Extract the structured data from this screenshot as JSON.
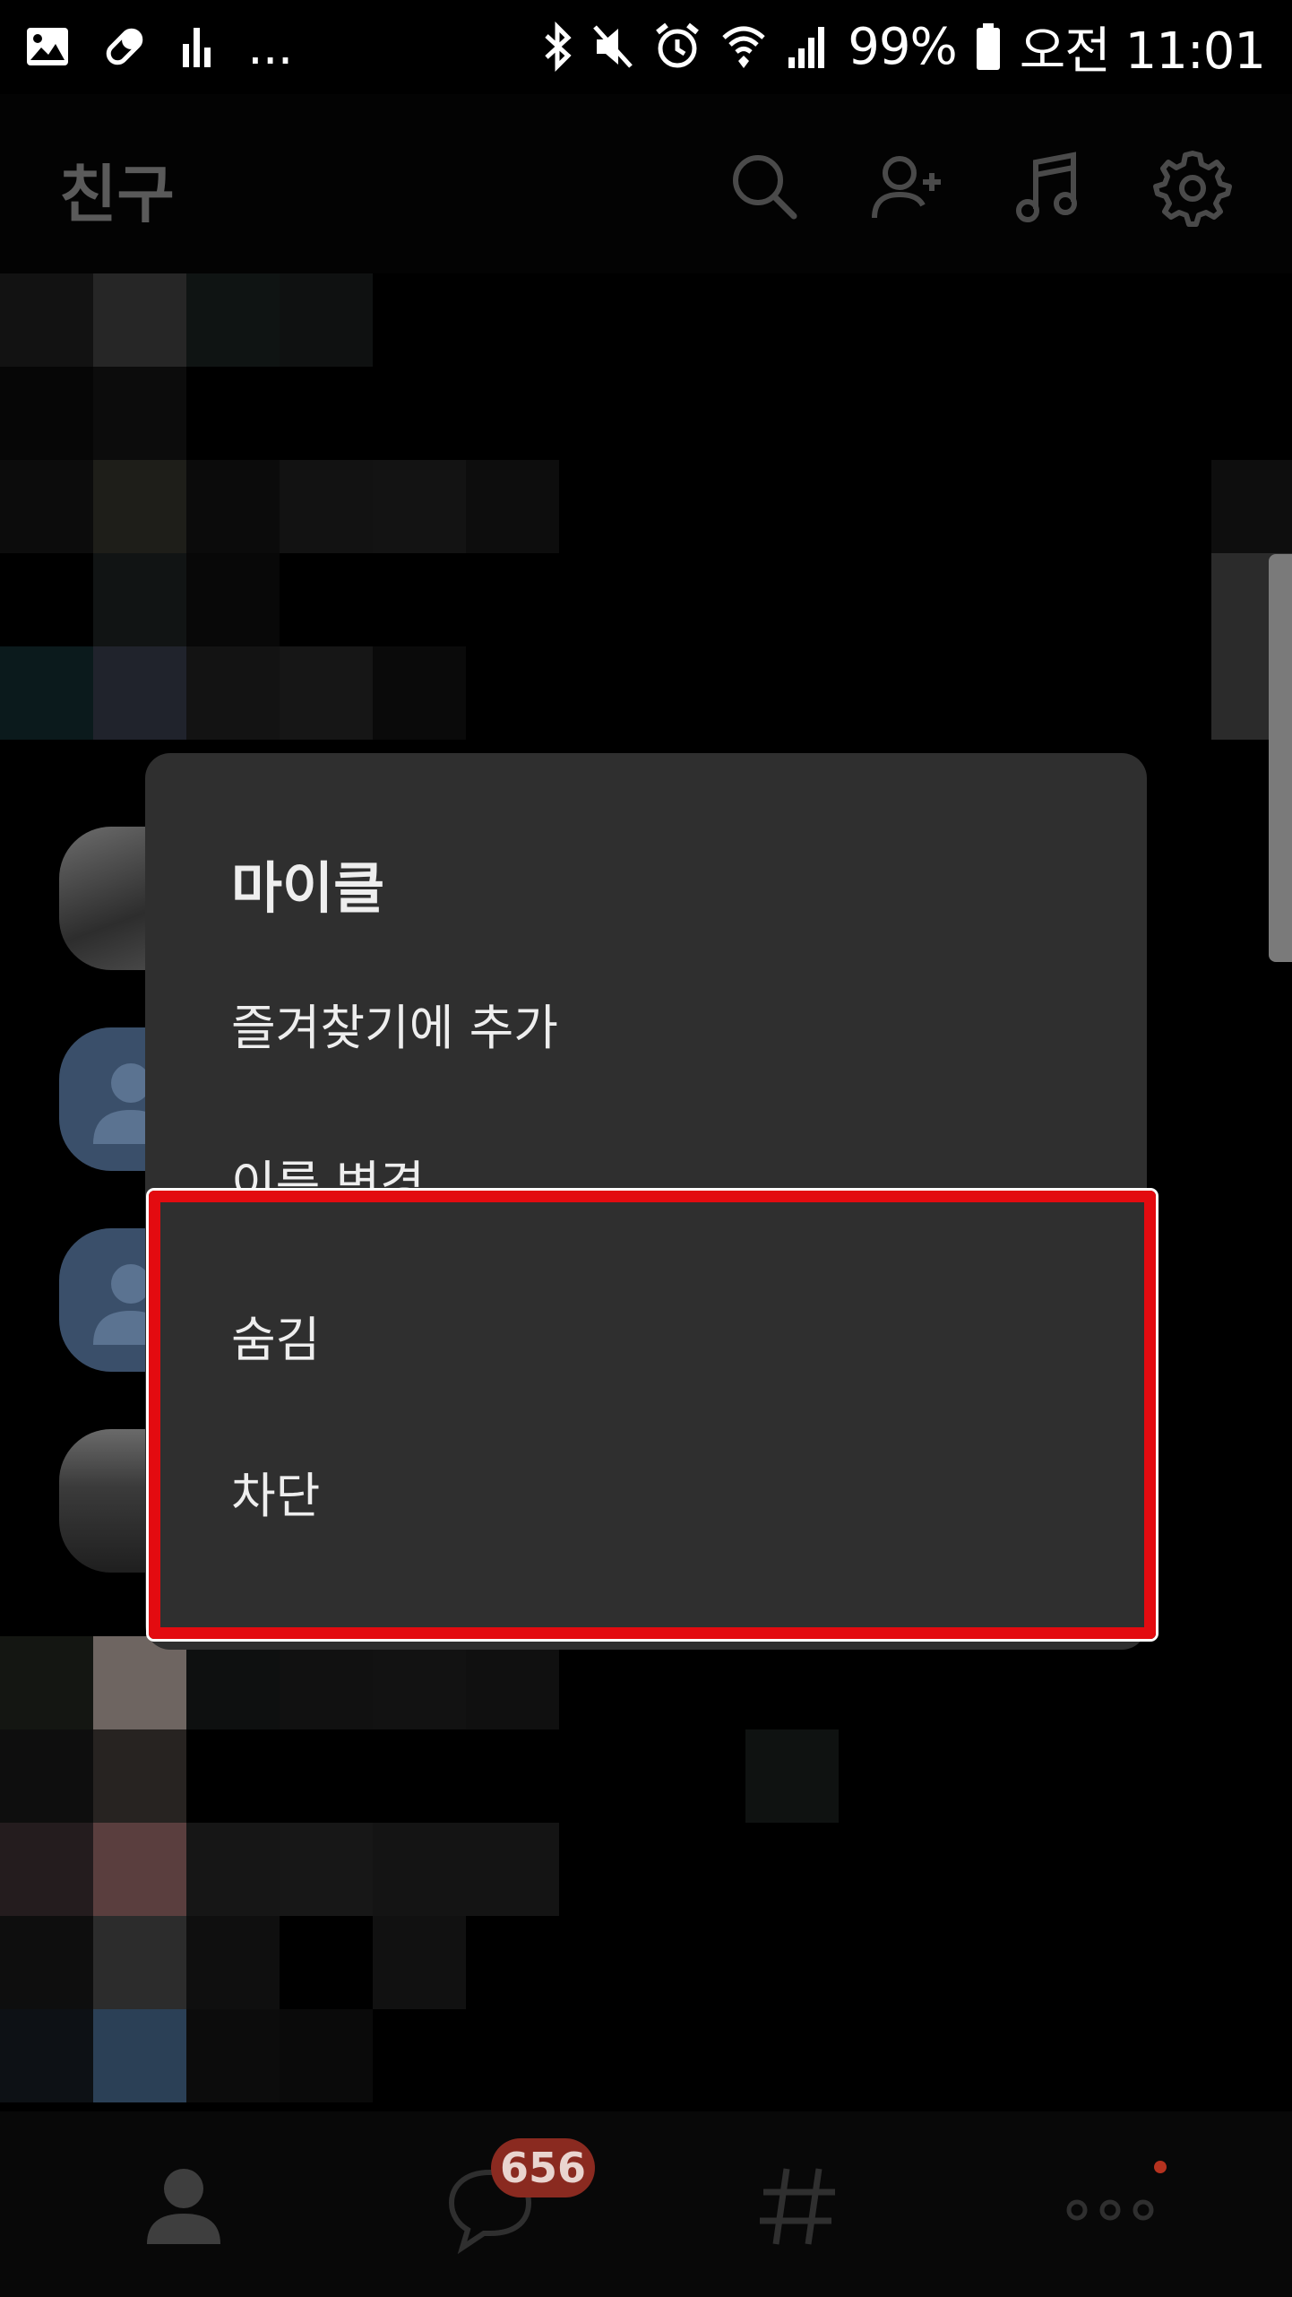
{
  "status_bar": {
    "ellipsis": "...",
    "battery": "99%",
    "time": "오전 11:01",
    "icons": [
      "gallery-icon",
      "pill-icon",
      "signal-bars-icon",
      "bluetooth-icon",
      "mute-icon",
      "alarm-icon",
      "wifi-icon",
      "cell-signal-icon",
      "battery-icon"
    ]
  },
  "header": {
    "title": "친구",
    "icons": [
      "search-icon",
      "add-friend-icon",
      "music-icon",
      "gear-icon"
    ]
  },
  "dialog": {
    "title": "마이클",
    "items": [
      {
        "label": "즐겨찾기에 추가"
      },
      {
        "label": "이름 변경"
      },
      {
        "label": "숨김"
      },
      {
        "label": "차단"
      }
    ]
  },
  "highlight": {
    "color": "#e30b10"
  },
  "bottom_nav": {
    "tabs": [
      {
        "icon": "person-icon",
        "active": true
      },
      {
        "icon": "chat-icon",
        "badge": "656"
      },
      {
        "icon": "hashtag-icon"
      },
      {
        "icon": "more-icon"
      }
    ]
  }
}
